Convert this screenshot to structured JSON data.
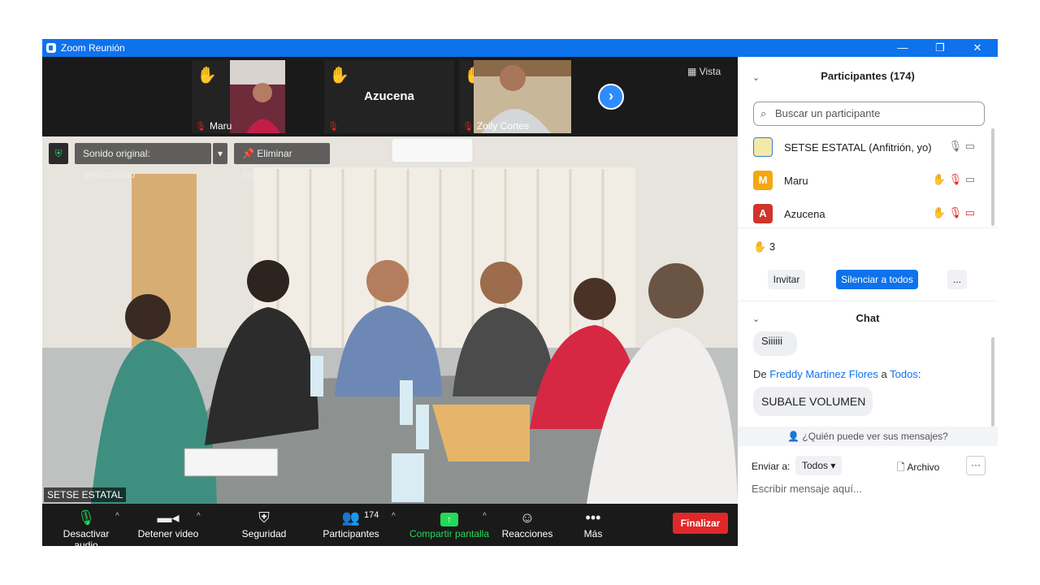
{
  "window": {
    "title": "Zoom Reunión",
    "minimize": "—",
    "restore": "❐",
    "close": "✕"
  },
  "strip": {
    "tiles": [
      {
        "name": "Maru"
      },
      {
        "name": "Azucena"
      },
      {
        "name": "Zoily Cortes"
      }
    ],
    "view_label": "Vista"
  },
  "main_video": {
    "sound_label": "Sonido original: desactivado",
    "unpin_label": "Eliminar anclaje",
    "speaker_name": "SETSE ESTATAL"
  },
  "toolbar": {
    "mute": "Desactivar audio",
    "video": "Detener video",
    "security": "Seguridad",
    "participants": "Participantes",
    "participants_count": "174",
    "share": "Compartir pantalla",
    "reactions": "Reacciones",
    "more": "Más",
    "end": "Finalizar",
    "share_color": "#23d959"
  },
  "participants_panel": {
    "title": "Participantes (174)",
    "search_placeholder": "Buscar un participante",
    "list": [
      {
        "name": "SETSE ESTATAL (Anfitrión, yo)",
        "initial": "",
        "color": "#f3e9a8"
      },
      {
        "name": "Maru",
        "initial": "M",
        "color": "#f3a712"
      },
      {
        "name": "Azucena",
        "initial": "A",
        "color": "#d0342c"
      }
    ],
    "raised_hands": "3",
    "invite": "Invitar",
    "mute_all": "Silenciar a todos",
    "more": "..."
  },
  "chat": {
    "title": "Chat",
    "prev_message": "Siiiiii",
    "from_prefix": "De",
    "from_name": "Freddy Martinez Flores",
    "to_word": "a",
    "to_name": "Todos",
    "colon": ":",
    "message": "SUBALE VOLUMEN",
    "privacy": "¿Quién puede ver sus mensajes?",
    "send_to_label": "Enviar a:",
    "send_to_value": "Todos",
    "file_label": "Archivo",
    "input_placeholder": "Escribir mensaje aquí..."
  }
}
